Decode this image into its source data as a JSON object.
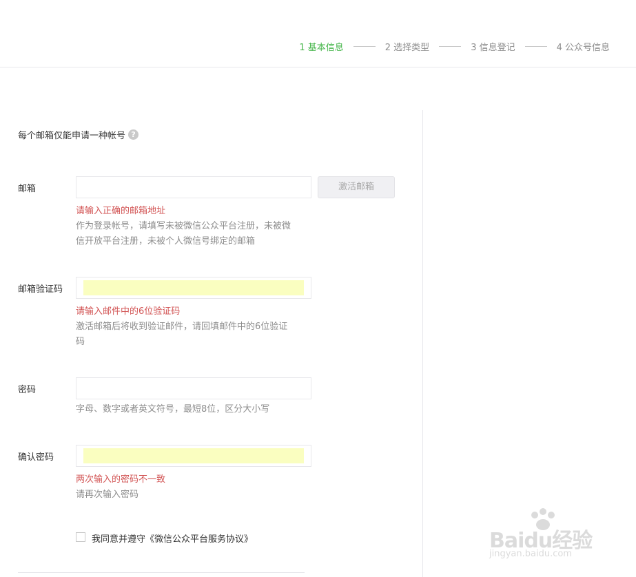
{
  "steps": [
    {
      "label": "1 基本信息"
    },
    {
      "label": "2 选择类型"
    },
    {
      "label": "3 信息登记"
    },
    {
      "label": "4 公众号信息"
    }
  ],
  "notice": {
    "text": "每个邮箱仅能申请一种帐号",
    "icon": "?"
  },
  "email": {
    "label": "邮箱",
    "value": "",
    "activate_button": "激活邮箱",
    "error": "请输入正确的邮箱地址",
    "tip": "作为登录帐号，请填写未被微信公众平台注册，未被微信开放平台注册，未被个人微信号绑定的邮箱"
  },
  "code": {
    "label": "邮箱验证码",
    "value": "",
    "error": "请输入邮件中的6位验证码",
    "tip": "激活邮箱后将收到验证邮件，请回填邮件中的6位验证码"
  },
  "password": {
    "label": "密码",
    "value": "",
    "tip": "字母、数字或者英文符号，最短8位，区分大小写"
  },
  "confirm": {
    "label": "确认密码",
    "value": "",
    "error": "两次输入的密码不一致",
    "tip": "请再次输入密码"
  },
  "agreement": {
    "text": "我同意并遵守《微信公众平台服务协议》",
    "checked": false
  },
  "watermark": {
    "brand": "Baidu经验",
    "sub": "jingyan.baidu.com"
  },
  "colors": {
    "active_step": "#44b549",
    "error": "#d25454",
    "autofill": "#fafec0"
  }
}
